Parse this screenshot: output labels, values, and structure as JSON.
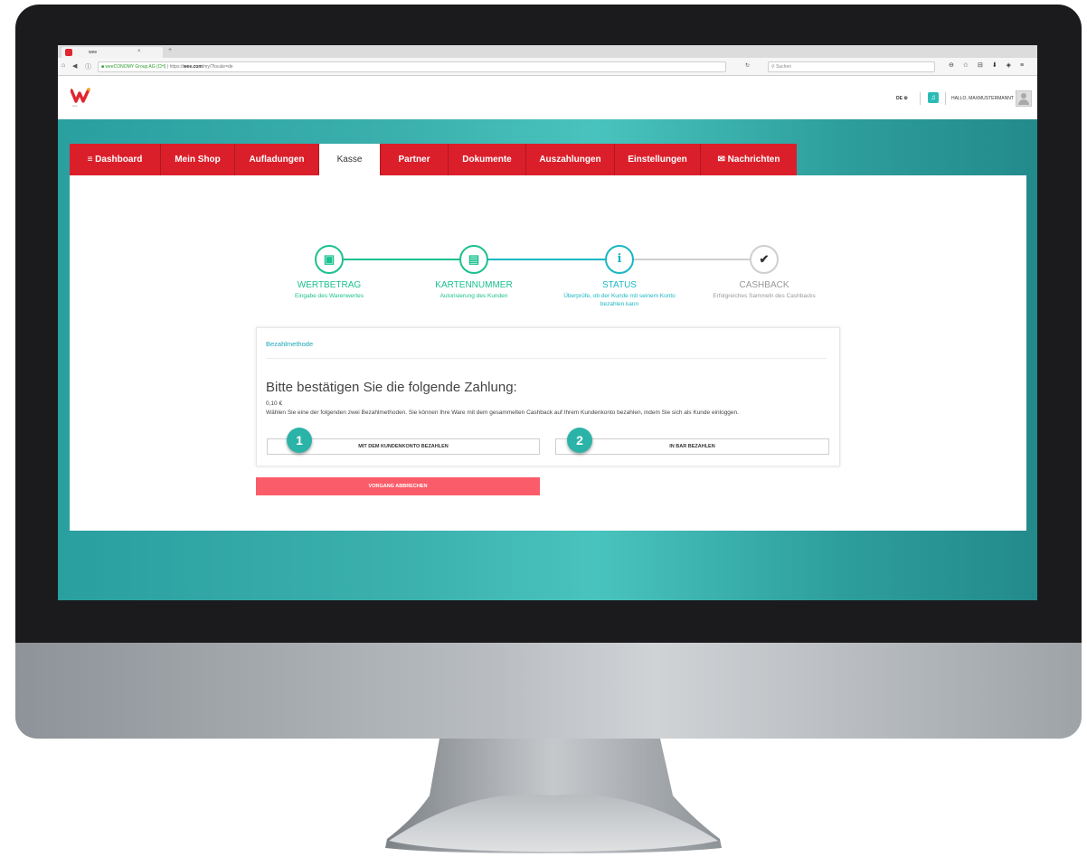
{
  "browser": {
    "tab_title": "wee",
    "tab_close": "×",
    "new_tab": "+",
    "url_org": "weeCONOMY Group AG (CH)",
    "url_rest_prefix": "https://",
    "url_host": "wee.com",
    "url_path": "/my/?locale=de",
    "search_placeholder": "Suchen",
    "toolbar_icons": "⊖ ☆ ⊟ ⬇ ◈ ≡"
  },
  "header": {
    "logo_caption": "wee",
    "language": "DE ⚙",
    "greeting": "HALLO, MAXMUSTERMANNT"
  },
  "nav": {
    "tabs": [
      {
        "label": "≡  Dashboard"
      },
      {
        "label": "Mein Shop"
      },
      {
        "label": "Aufladungen"
      },
      {
        "label": "Kasse"
      },
      {
        "label": "Partner"
      },
      {
        "label": "Dokumente"
      },
      {
        "label": "Auszahlungen"
      },
      {
        "label": "Einstellungen"
      },
      {
        "label": "✉  Nachrichten"
      }
    ],
    "active_index": 3
  },
  "steps": [
    {
      "icon": "banknote-icon",
      "glyph": "▣",
      "title": "WERTBETRAG",
      "subtitle": "Eingabe des Warenwertes",
      "color": "#1bc18f"
    },
    {
      "icon": "credit-card-icon",
      "glyph": "▤",
      "title": "KARTENNUMMER",
      "subtitle": "Autorisierung des Kunden",
      "color": "#1bc18f"
    },
    {
      "icon": "info-icon",
      "glyph": "i",
      "title": "STATUS",
      "subtitle": "Überprüfe, ob der Kunde mit seinem Konto bezahlen kann",
      "color": "#1ab7c3"
    },
    {
      "icon": "check-icon",
      "glyph": "✔",
      "title": "CASHBACK",
      "subtitle": "Erfolgreiches Sammeln des Cashbacks",
      "color": "#999999"
    }
  ],
  "payment": {
    "section_label": "Bezahlmethode",
    "heading": "Bitte bestätigen Sie die folgende Zahlung:",
    "amount": "0,10 €",
    "description": "Wählen Sie eine der folgenden zwei Bezahlmethoden. Sie können Ihre Ware mit dem gesammelten Cashback auf Ihrem Kundenkonto bezahlen, indem Sie sich als Kunde einloggen.",
    "btn_account": "MIT DEM KUNDENKONTO BEZAHLEN",
    "btn_cash": "IN BAR BEZAHLEN",
    "badge_1": "1",
    "badge_2": "2",
    "cancel": "VORGANG ABBRECHEN"
  },
  "colors": {
    "brand_red": "#db1f2a",
    "teal": "#2bbbb6",
    "cancel_red": "#fb5c69",
    "step_green": "#1bc18f",
    "step_blue": "#1ab7c3"
  }
}
